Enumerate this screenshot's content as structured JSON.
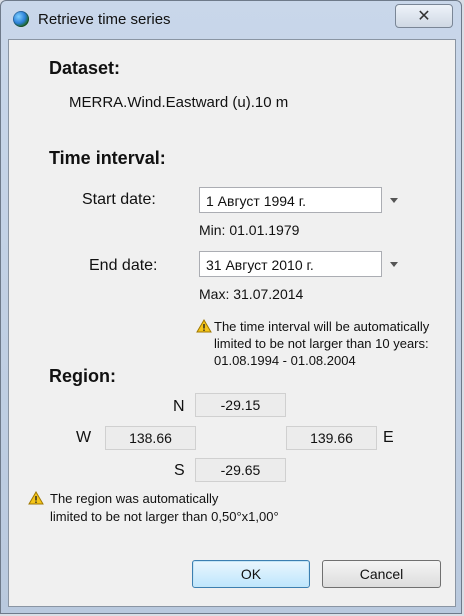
{
  "window": {
    "title": "Retrieve time series",
    "close_label": "✕"
  },
  "dataset": {
    "heading": "Dataset:",
    "name": "MERRA.Wind.Eastward (u).10 m"
  },
  "time_interval": {
    "heading": "Time interval:",
    "start_label": "Start date:",
    "start_value": "1 Август 1994 г.",
    "min_text": "Min:  01.01.1979",
    "end_label": "End date:",
    "end_value": "31 Август 2010 г.",
    "max_text": "Max:  31.07.2014",
    "warning_line1": "The time interval will be automatically",
    "warning_line2": "limited to be not larger than 10 years:",
    "warning_line3": "01.08.1994 - 01.08.2004"
  },
  "region": {
    "heading": "Region:",
    "n_label": "N",
    "n_value": "-29.15",
    "w_label": "W",
    "w_value": "138.66",
    "e_value": "139.66",
    "e_label": "E",
    "s_label": "S",
    "s_value": "-29.65",
    "warning_line1": "The region was automatically",
    "warning_line2": "limited to be not larger than 0,50°x1,00°"
  },
  "buttons": {
    "ok": "OK",
    "cancel": "Cancel"
  },
  "icons": {
    "app": "globe-icon",
    "close": "close-icon",
    "warning": "warning-icon",
    "dropdown": "chevron-down-icon"
  }
}
